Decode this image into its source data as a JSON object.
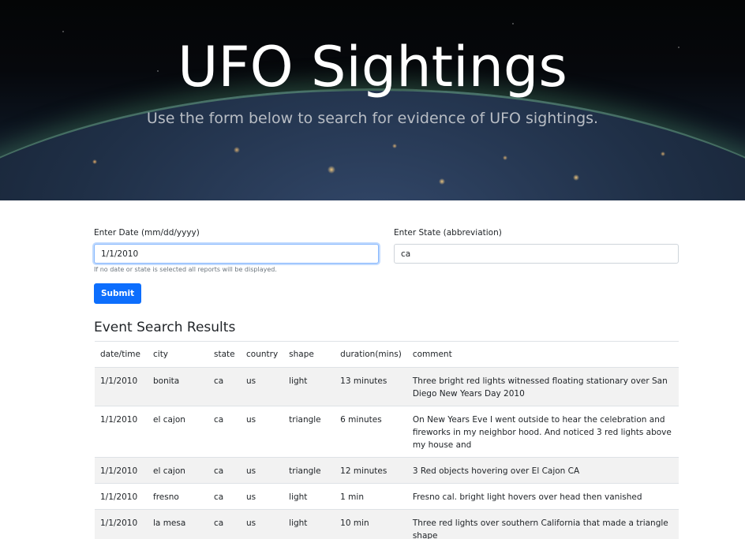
{
  "hero": {
    "title": "UFO Sightings",
    "lead": "Use the form below to search for evidence of UFO sightings."
  },
  "form": {
    "date_label": "Enter Date (mm/dd/yyyy)",
    "date_value": "1/1/2010",
    "state_label": "Enter State (abbreviation)",
    "state_value": "ca",
    "help_text": "If no date or state is selected all reports will be displayed.",
    "submit_label": "Submit"
  },
  "results": {
    "title": "Event Search Results",
    "columns": [
      "date/time",
      "city",
      "state",
      "country",
      "shape",
      "duration(mins)",
      "comment"
    ],
    "rows": [
      {
        "datetime": "1/1/2010",
        "city": "bonita",
        "state": "ca",
        "country": "us",
        "shape": "light",
        "duration": "13 minutes",
        "comment": "Three bright red lights witnessed floating stationary over San Diego New Years Day 2010"
      },
      {
        "datetime": "1/1/2010",
        "city": "el cajon",
        "state": "ca",
        "country": "us",
        "shape": "triangle",
        "duration": "6 minutes",
        "comment": "On New Years Eve I went outside to hear the celebration and fireworks in my neighbor hood. And noticed 3 red lights above my house and"
      },
      {
        "datetime": "1/1/2010",
        "city": "el cajon",
        "state": "ca",
        "country": "us",
        "shape": "triangle",
        "duration": "12 minutes",
        "comment": "3 Red objects hovering over El Cajon CA"
      },
      {
        "datetime": "1/1/2010",
        "city": "fresno",
        "state": "ca",
        "country": "us",
        "shape": "light",
        "duration": "1 min",
        "comment": "Fresno cal. bright light hovers over head then vanished"
      },
      {
        "datetime": "1/1/2010",
        "city": "la mesa",
        "state": "ca",
        "country": "us",
        "shape": "light",
        "duration": "10 min",
        "comment": "Three red lights over southern California that made a triangle shape"
      }
    ]
  }
}
